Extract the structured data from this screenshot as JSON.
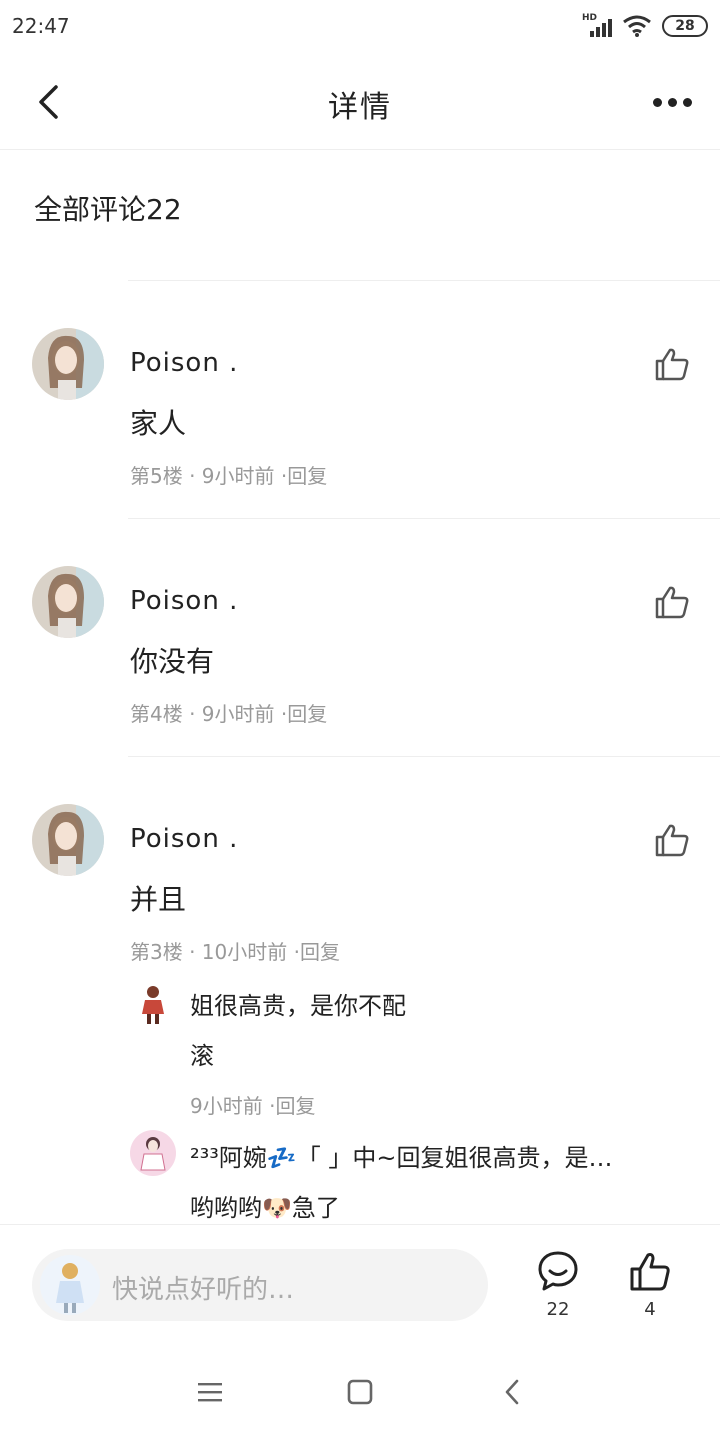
{
  "status_bar": {
    "time": "22:47",
    "network": "HD",
    "battery": "28"
  },
  "header": {
    "title": "详情"
  },
  "comments_header": {
    "label": "全部评论22"
  },
  "comments": [
    {
      "username": "Poison .",
      "text": "家人",
      "meta": "第5楼 · 9小时前 ·回复"
    },
    {
      "username": "Poison .",
      "text": "你没有",
      "meta": "第4楼 · 9小时前 ·回复"
    },
    {
      "username": "Poison .",
      "text": "并且",
      "meta": "第3楼 · 10小时前 ·回复",
      "replies": [
        {
          "text_line1": "姐很高贵，是你不配",
          "text_line2": "滚",
          "meta": "9小时前 ·回复"
        },
        {
          "head": "²³³阿婉💤「    」中~回复姐很高贵，是…",
          "text": "哟哟哟🐶急了"
        }
      ]
    }
  ],
  "bottom_bar": {
    "placeholder": "快说点好听的…",
    "comment_count": "22",
    "like_count": "4"
  }
}
